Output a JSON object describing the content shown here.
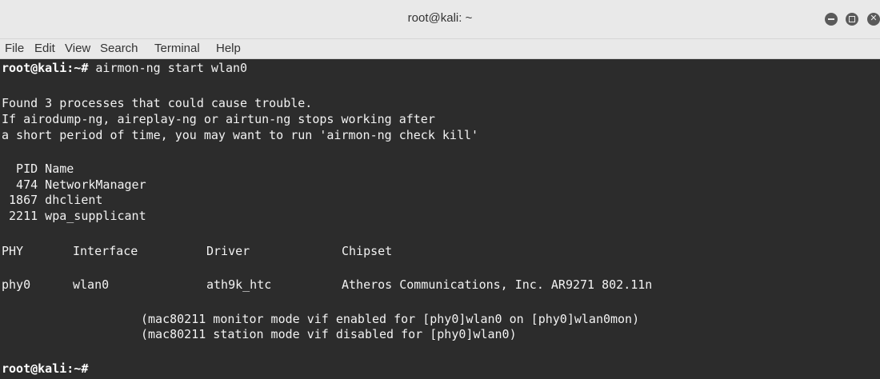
{
  "window": {
    "title": "root@kali: ~"
  },
  "menubar": {
    "items": [
      "File",
      "Edit",
      "View",
      "Search",
      "Terminal",
      "Help"
    ]
  },
  "terminal": {
    "prompt": {
      "user": "root",
      "at": "@",
      "host": "kali",
      "path": ":~#"
    },
    "command": " airmon-ng start wlan0",
    "messages": [
      "Found 3 processes that could cause trouble.",
      "If airodump-ng, aireplay-ng or airtun-ng stops working after",
      "a short period of time, you may want to run 'airmon-ng check kill'"
    ],
    "process_table": {
      "header": "  PID Name",
      "rows": [
        "  474 NetworkManager",
        " 1867 dhclient",
        " 2211 wpa_supplicant"
      ]
    },
    "interface_table": {
      "header": "PHY\tInterface\tDriver\t\tChipset",
      "header_cells": [
        "PHY",
        "Interface",
        "Driver",
        "Chipset"
      ],
      "row_cells": [
        "phy0",
        "wlan0",
        "ath9k_htc",
        "Atheros Communications, Inc. AR9271 802.11n"
      ]
    },
    "notes": [
      "(mac80211 monitor mode vif enabled for [phy0]wlan0 on [phy0]wlan0mon)",
      "(mac80211 station mode vif disabled for [phy0]wlan0)"
    ]
  },
  "colors": {
    "terminal_bg": "#2c2c2c",
    "terminal_fg": "#f2f2f2",
    "titlebar_bg": "#e9e9e9"
  },
  "icons": [
    "minimize-icon",
    "maximize-icon",
    "close-icon"
  ]
}
